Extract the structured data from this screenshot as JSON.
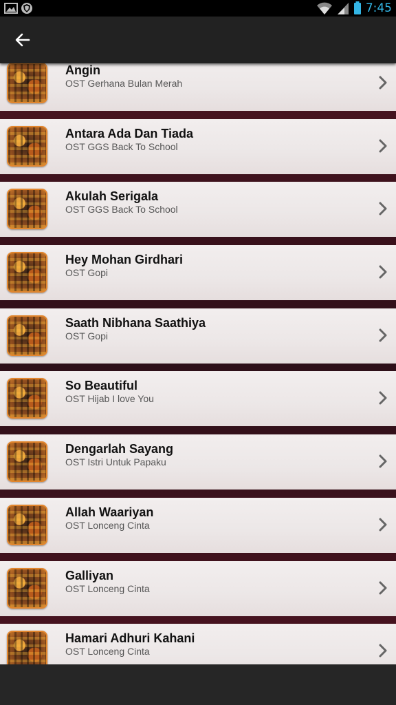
{
  "status_bar": {
    "time": "7:45",
    "icons": [
      "gallery-icon",
      "shield-icon",
      "wifi-icon",
      "signal-icon",
      "battery-icon"
    ]
  },
  "app_bar": {
    "back_icon": "arrow-left-icon"
  },
  "songs": [
    {
      "title": "Angin",
      "subtitle": "OST Gerhana Bulan Merah"
    },
    {
      "title": "Antara Ada Dan Tiada",
      "subtitle": "OST GGS Back To School"
    },
    {
      "title": "Akulah Serigala",
      "subtitle": "OST GGS Back To School"
    },
    {
      "title": "Hey Mohan Girdhari",
      "subtitle": "OST Gopi"
    },
    {
      "title": "Saath Nibhana Saathiya",
      "subtitle": "OST Gopi"
    },
    {
      "title": "So Beautiful",
      "subtitle": "OST Hijab I love You"
    },
    {
      "title": "Dengarlah Sayang",
      "subtitle": "OST Istri Untuk Papaku"
    },
    {
      "title": "Allah Waariyan",
      "subtitle": "OST Lonceng Cinta"
    },
    {
      "title": "Galliyan",
      "subtitle": "OST Lonceng Cinta"
    },
    {
      "title": "Hamari Adhuri Kahani",
      "subtitle": "OST Lonceng Cinta"
    }
  ],
  "colors": {
    "status_accent": "#33b5e5",
    "thumb_border": "#e2862e",
    "divider": "#4a1420"
  }
}
